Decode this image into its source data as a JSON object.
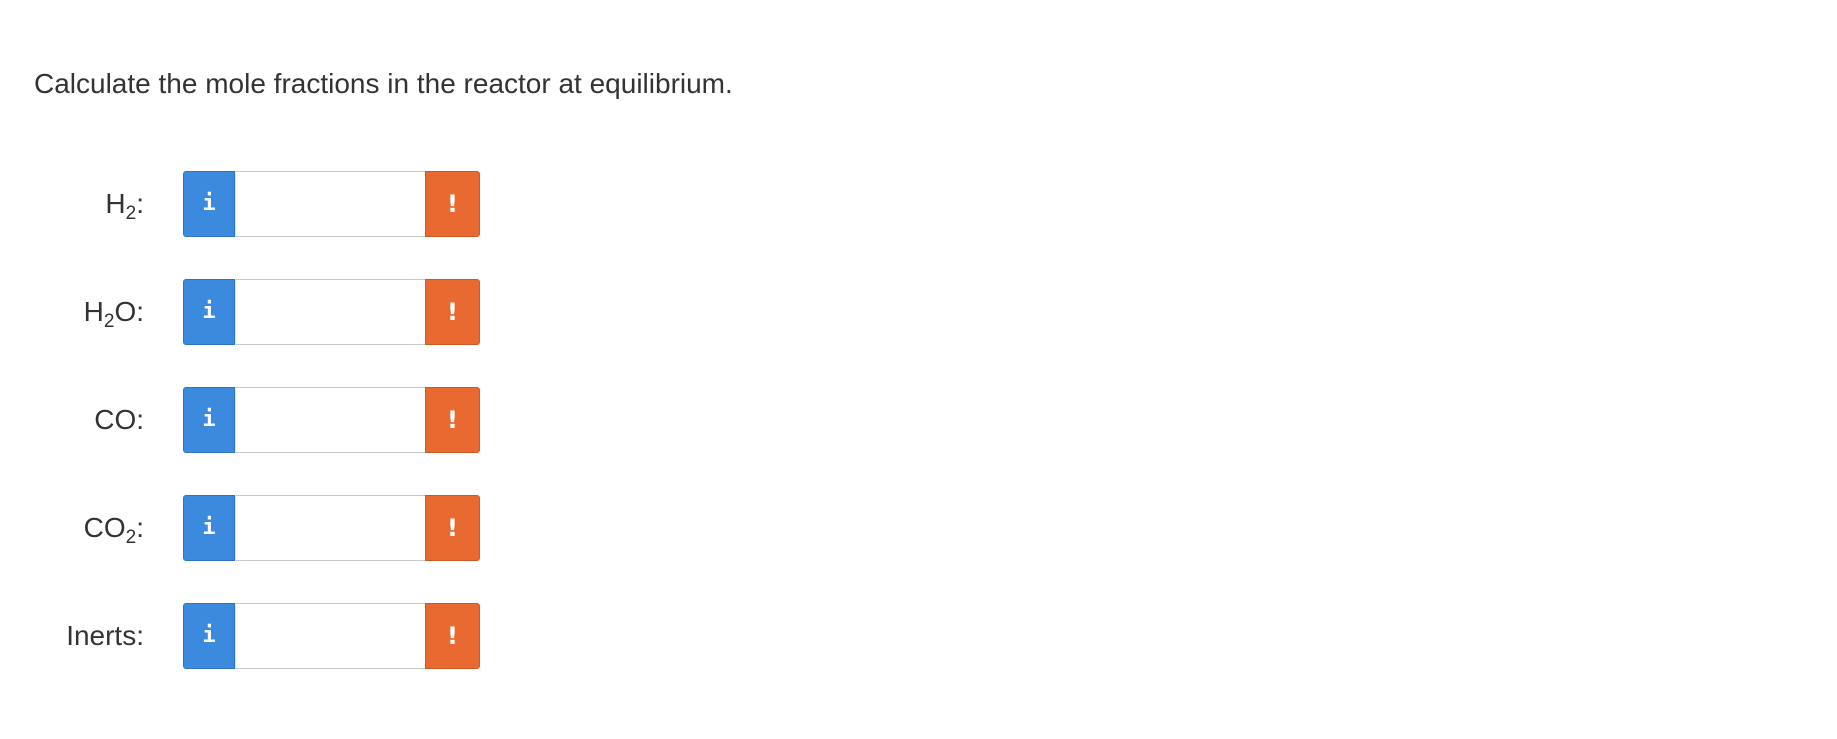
{
  "question": {
    "text": "Calculate the mole fractions in the reactor at equilibrium."
  },
  "rows": [
    {
      "label_pre": "H",
      "label_sub": "2",
      "label_post": ":",
      "value": "",
      "info_icon": "i",
      "warn_icon": "!"
    },
    {
      "label_pre": "H",
      "label_sub": "2",
      "label_post": "O:",
      "value": "",
      "info_icon": "i",
      "warn_icon": "!"
    },
    {
      "label_pre": "CO:",
      "label_sub": "",
      "label_post": "",
      "value": "",
      "info_icon": "i",
      "warn_icon": "!"
    },
    {
      "label_pre": "CO",
      "label_sub": "2",
      "label_post": ":",
      "value": "",
      "info_icon": "i",
      "warn_icon": "!"
    },
    {
      "label_pre": "Inerts:",
      "label_sub": "",
      "label_post": "",
      "value": "",
      "info_icon": "i",
      "warn_icon": "!"
    }
  ],
  "colors": {
    "info_button": "#3b8ade",
    "warning_button": "#e96a31",
    "text": "#333333",
    "input_border": "#c8c8c8"
  },
  "icons": {
    "info": "info-icon",
    "warning": "exclamation-icon"
  }
}
